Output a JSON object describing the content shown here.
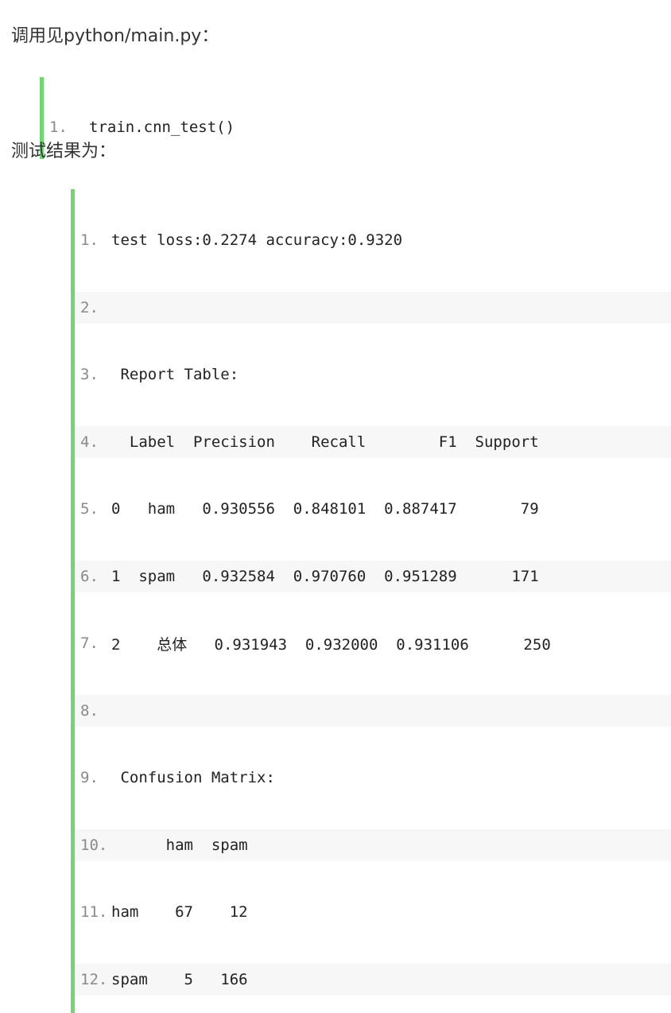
{
  "intro": {
    "call_text": "调用见python/main.py：",
    "result_text": "测试结果为："
  },
  "call_code": {
    "lines": [
      {
        "num": "1.",
        "text": "train.cnn_test()"
      }
    ]
  },
  "result_code": {
    "lines": [
      {
        "num": "1.",
        "text": "test loss:0.2274 accuracy:0.9320"
      },
      {
        "num": "2.",
        "text": ""
      },
      {
        "num": "3.",
        "text": " Report Table:"
      },
      {
        "num": "4.",
        "text": "  Label  Precision    Recall        F1  Support"
      },
      {
        "num": "5.",
        "text": "0   ham   0.930556  0.848101  0.887417       79"
      },
      {
        "num": "6.",
        "text": "1  spam   0.932584  0.970760  0.951289      171"
      },
      {
        "num": "7.",
        "text": "2    总体   0.931943  0.932000  0.931106      250"
      },
      {
        "num": "8.",
        "text": ""
      },
      {
        "num": "9.",
        "text": " Confusion Matrix:"
      },
      {
        "num": "10.",
        "text": "      ham  spam"
      },
      {
        "num": "11.",
        "text": "ham    67    12"
      },
      {
        "num": "12.",
        "text": "spam    5   166"
      }
    ]
  },
  "colors": {
    "code_border": "#6fd672",
    "alt_row_bg": "#f7f7f7",
    "line_number": "#8a8a8a",
    "text": "#333333"
  }
}
